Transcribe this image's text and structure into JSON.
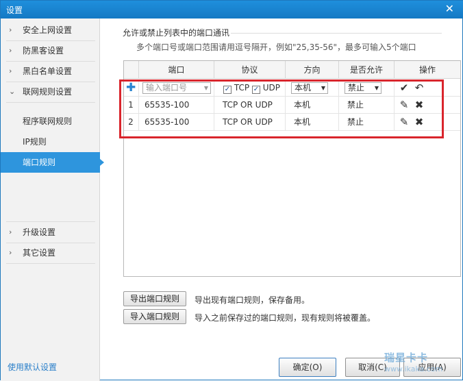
{
  "window": {
    "title": "设置",
    "close_glyph": "✕"
  },
  "sidebar": {
    "items": [
      {
        "label": "安全上网设置",
        "chevron": "›"
      },
      {
        "label": "防黑客设置",
        "chevron": "›"
      },
      {
        "label": "黑白名单设置",
        "chevron": "›"
      },
      {
        "label": "联网规则设置",
        "chevron": "⌄"
      }
    ],
    "subitems": [
      {
        "label": "程序联网规则"
      },
      {
        "label": "IP规则"
      },
      {
        "label": "端口规则"
      }
    ],
    "lower_items": [
      {
        "label": "升级设置",
        "chevron": "›"
      },
      {
        "label": "其它设置",
        "chevron": "›"
      }
    ],
    "defaults_link": "使用默认设置"
  },
  "main": {
    "description_line1": "允许或禁止列表中的端口通讯",
    "description_line2": "多个端口号或端口范围请用逗号隔开，例如\"25,35-56\"，最多可输入5个端口",
    "table": {
      "headers": [
        "端口",
        "协议",
        "方向",
        "是否允许",
        "操作"
      ],
      "new_row": {
        "port_placeholder": "输入端口号",
        "tcp_label": "TCP",
        "udp_label": "UDP",
        "direction": "本机",
        "allow": "禁止",
        "confirm_icon": "✔",
        "undo_icon": "↶"
      },
      "rows": [
        {
          "num": "1",
          "port": "65535-100",
          "protocol": "TCP OR UDP",
          "direction": "本机",
          "allow": "禁止"
        },
        {
          "num": "2",
          "port": "65535-100",
          "protocol": "TCP OR UDP",
          "direction": "本机",
          "allow": "禁止"
        }
      ]
    },
    "export_button": "导出端口规则",
    "export_desc": "导出现有端口规则，保存备用。",
    "import_button": "导入端口规则",
    "import_desc": "导入之前保存过的端口规则，现有规则将被覆盖。"
  },
  "footer": {
    "ok": "确定(O)",
    "cancel": "取消(C)",
    "apply": "应用(A)"
  },
  "watermark": {
    "text": "瑞星卡卡",
    "sub": "www.ikaka.com"
  },
  "colors": {
    "accent": "#2e95dd",
    "highlight_box": "#d9252c",
    "titlebar": "#1479c4"
  }
}
